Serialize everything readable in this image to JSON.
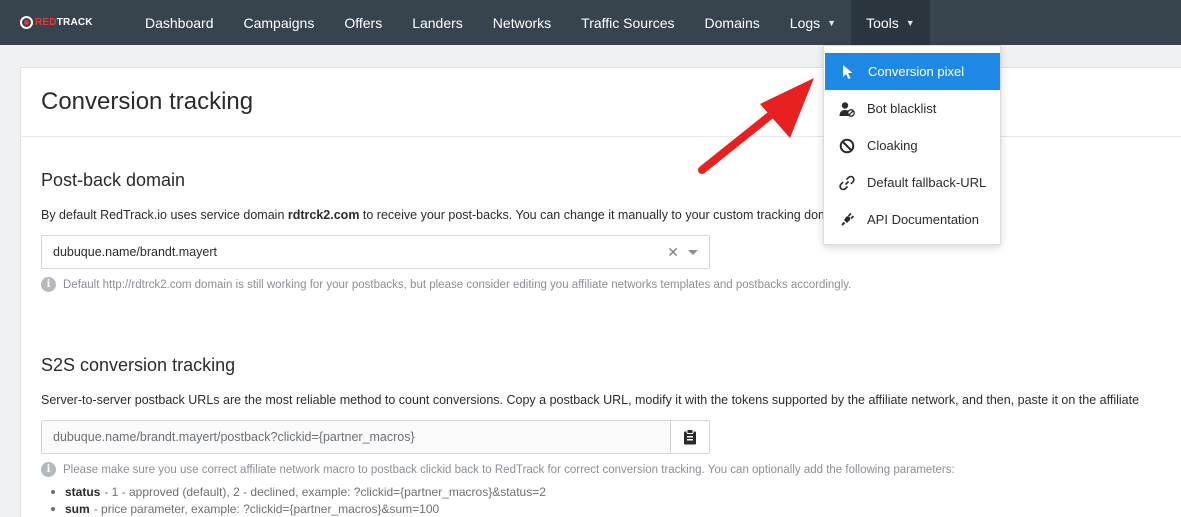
{
  "brand": {
    "logo_red": "RED",
    "logo_white": "TRACK"
  },
  "nav": {
    "items": [
      "Dashboard",
      "Campaigns",
      "Offers",
      "Landers",
      "Networks",
      "Traffic Sources",
      "Domains"
    ],
    "logs_label": "Logs",
    "tools_label": "Tools"
  },
  "tools_menu": {
    "items": [
      {
        "label": "Conversion pixel",
        "icon": "cursor-icon"
      },
      {
        "label": "Bot blacklist",
        "icon": "user-block-icon"
      },
      {
        "label": "Cloaking",
        "icon": "ban-icon"
      },
      {
        "label": "Default fallback-URL",
        "icon": "link-icon"
      },
      {
        "label": "API Documentation",
        "icon": "plug-icon"
      }
    ]
  },
  "page": {
    "title": "Conversion tracking"
  },
  "postback": {
    "title": "Post-back domain",
    "desc_prefix": "By default RedTrack.io uses service domain ",
    "desc_domain": "rdtrck2.com",
    "desc_suffix": " to receive your post-backs. You can change it manually to your custom tracking domain below.",
    "selected_domain": "dubuque.name/brandt.mayert",
    "hint": "Default http://rdtrck2.com domain is still working for your postbacks, but please consider editing you affiliate networks templates and postbacks accordingly."
  },
  "s2s": {
    "title": "S2S conversion tracking",
    "desc": "Server-to-server postback URLs are the most reliable method to count conversions. Copy a postback URL, modify it with the tokens supported by the affiliate network, and then, paste it on the affiliate",
    "url": "dubuque.name/brandt.mayert/postback?clickid={partner_macros}",
    "hint": "Please make sure you use correct affiliate network macro to postback clickid back to RedTrack for correct conversion tracking. You can optionally add the following parameters:",
    "params": [
      {
        "key": "status",
        "text": "- 1 - approved (default), 2 - declined, example: ?clickid={partner_macros}&status=2"
      },
      {
        "key": "sum",
        "text": "- price parameter, example: ?clickid={partner_macros}&sum=100"
      }
    ]
  },
  "colors": {
    "navbar": "#37434d",
    "active_menu": "#1e88e5",
    "arrow": "#e8201f",
    "brand_red": "#e53935"
  }
}
